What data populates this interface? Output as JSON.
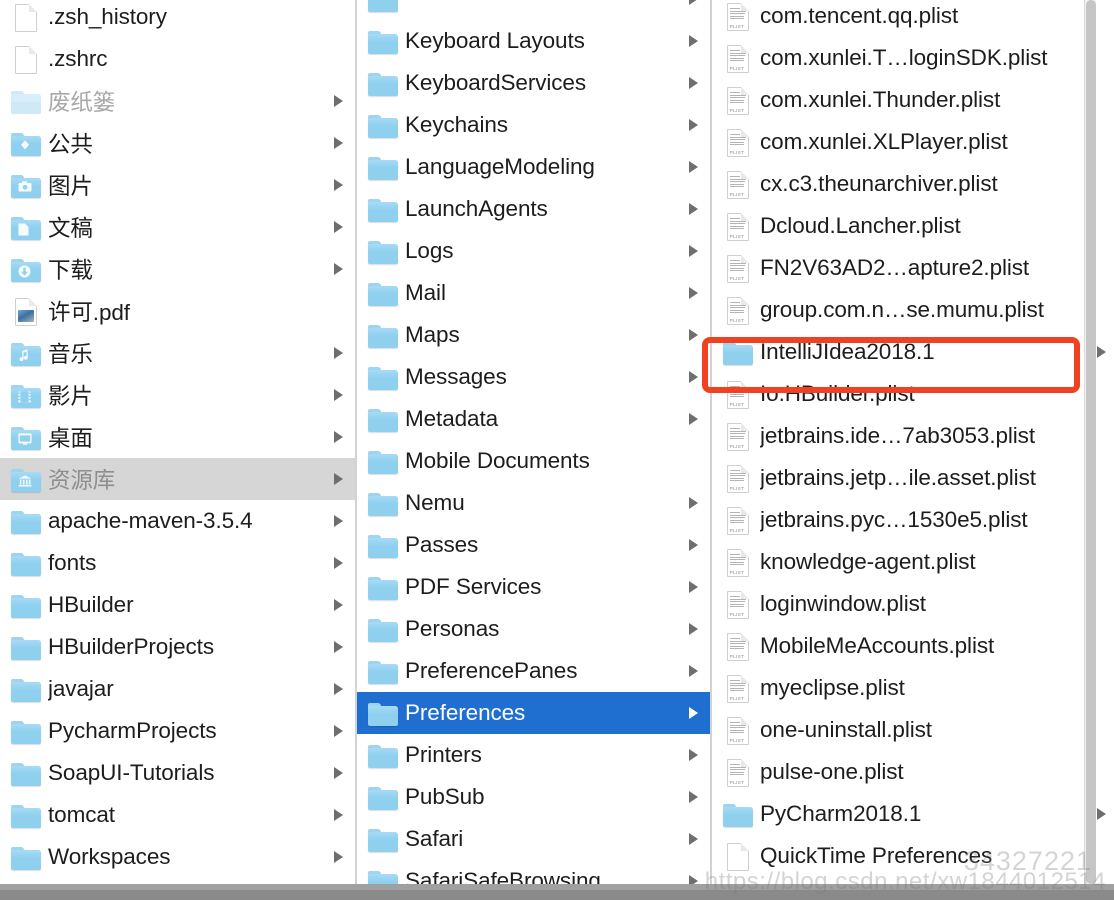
{
  "window": {
    "kind": "macos-finder-column-view",
    "accent_color": "#1f6fd0",
    "highlight_color": "#f04223",
    "folder_color": "#8fd0ef"
  },
  "columns": [
    {
      "name": "home-folder-column",
      "items": [
        {
          "label": ".zsh_history",
          "icon": "document-icon",
          "arrow": false,
          "state": "normal"
        },
        {
          "label": ".zshrc",
          "icon": "document-icon",
          "arrow": false,
          "state": "normal"
        },
        {
          "label": "废纸篓",
          "icon": "folder-icon",
          "arrow": true,
          "state": "dim"
        },
        {
          "label": "公共",
          "icon": "folder-public-icon",
          "arrow": true,
          "state": "normal"
        },
        {
          "label": "图片",
          "icon": "folder-pictures-icon",
          "arrow": true,
          "state": "normal"
        },
        {
          "label": "文稿",
          "icon": "folder-documents-icon",
          "arrow": true,
          "state": "normal"
        },
        {
          "label": "下载",
          "icon": "folder-downloads-icon",
          "arrow": true,
          "state": "normal"
        },
        {
          "label": "许可.pdf",
          "icon": "pdf-icon",
          "arrow": false,
          "state": "normal"
        },
        {
          "label": "音乐",
          "icon": "folder-music-icon",
          "arrow": true,
          "state": "normal"
        },
        {
          "label": "影片",
          "icon": "folder-movies-icon",
          "arrow": true,
          "state": "normal"
        },
        {
          "label": "桌面",
          "icon": "folder-desktop-icon",
          "arrow": true,
          "state": "normal"
        },
        {
          "label": "资源库",
          "icon": "folder-library-icon",
          "arrow": true,
          "state": "selected-inactive"
        },
        {
          "label": "apache-maven-3.5.4",
          "icon": "folder-icon",
          "arrow": true,
          "state": "normal"
        },
        {
          "label": "fonts",
          "icon": "folder-icon",
          "arrow": true,
          "state": "normal"
        },
        {
          "label": "HBuilder",
          "icon": "folder-icon",
          "arrow": true,
          "state": "normal"
        },
        {
          "label": "HBuilderProjects",
          "icon": "folder-icon",
          "arrow": true,
          "state": "normal"
        },
        {
          "label": "javajar",
          "icon": "folder-icon",
          "arrow": true,
          "state": "normal"
        },
        {
          "label": "PycharmProjects",
          "icon": "folder-icon",
          "arrow": true,
          "state": "normal"
        },
        {
          "label": "SoapUI-Tutorials",
          "icon": "folder-icon",
          "arrow": true,
          "state": "normal"
        },
        {
          "label": "tomcat",
          "icon": "folder-icon",
          "arrow": true,
          "state": "normal"
        },
        {
          "label": "Workspaces",
          "icon": "folder-icon",
          "arrow": true,
          "state": "normal"
        }
      ]
    },
    {
      "name": "library-folder-column",
      "items": [
        {
          "label": "",
          "icon": "folder-icon",
          "arrow": true,
          "state": "normal"
        },
        {
          "label": "Keyboard Layouts",
          "icon": "folder-icon",
          "arrow": true,
          "state": "normal"
        },
        {
          "label": "KeyboardServices",
          "icon": "folder-icon",
          "arrow": true,
          "state": "normal"
        },
        {
          "label": "Keychains",
          "icon": "folder-icon",
          "arrow": true,
          "state": "normal"
        },
        {
          "label": "LanguageModeling",
          "icon": "folder-icon",
          "arrow": true,
          "state": "normal"
        },
        {
          "label": "LaunchAgents",
          "icon": "folder-icon",
          "arrow": true,
          "state": "normal"
        },
        {
          "label": "Logs",
          "icon": "folder-icon",
          "arrow": true,
          "state": "normal"
        },
        {
          "label": "Mail",
          "icon": "folder-icon",
          "arrow": true,
          "state": "normal"
        },
        {
          "label": "Maps",
          "icon": "folder-icon",
          "arrow": true,
          "state": "normal"
        },
        {
          "label": "Messages",
          "icon": "folder-icon",
          "arrow": true,
          "state": "normal"
        },
        {
          "label": "Metadata",
          "icon": "folder-icon",
          "arrow": true,
          "state": "normal"
        },
        {
          "label": "Mobile Documents",
          "icon": "folder-icon",
          "arrow": false,
          "state": "normal"
        },
        {
          "label": "Nemu",
          "icon": "folder-icon",
          "arrow": true,
          "state": "normal"
        },
        {
          "label": "Passes",
          "icon": "folder-icon",
          "arrow": true,
          "state": "normal"
        },
        {
          "label": "PDF Services",
          "icon": "folder-icon",
          "arrow": true,
          "state": "normal"
        },
        {
          "label": "Personas",
          "icon": "folder-icon",
          "arrow": true,
          "state": "normal"
        },
        {
          "label": "PreferencePanes",
          "icon": "folder-icon",
          "arrow": true,
          "state": "normal"
        },
        {
          "label": "Preferences",
          "icon": "folder-icon",
          "arrow": true,
          "state": "selected"
        },
        {
          "label": "Printers",
          "icon": "folder-icon",
          "arrow": true,
          "state": "normal"
        },
        {
          "label": "PubSub",
          "icon": "folder-icon",
          "arrow": true,
          "state": "normal"
        },
        {
          "label": "Safari",
          "icon": "folder-icon",
          "arrow": true,
          "state": "normal"
        },
        {
          "label": "SafariSafeBrowsing",
          "icon": "folder-icon",
          "arrow": true,
          "state": "normal"
        }
      ]
    },
    {
      "name": "preferences-contents-column",
      "items": [
        {
          "label": "com.tencent.qq.plist",
          "icon": "plist-file-icon",
          "arrow": false,
          "state": "normal"
        },
        {
          "label": "com.xunlei.T…loginSDK.plist",
          "icon": "plist-file-icon",
          "arrow": false,
          "state": "normal"
        },
        {
          "label": "com.xunlei.Thunder.plist",
          "icon": "plist-file-icon",
          "arrow": false,
          "state": "normal"
        },
        {
          "label": "com.xunlei.XLPlayer.plist",
          "icon": "plist-file-icon",
          "arrow": false,
          "state": "normal"
        },
        {
          "label": "cx.c3.theunarchiver.plist",
          "icon": "plist-file-icon",
          "arrow": false,
          "state": "normal"
        },
        {
          "label": "Dcloud.Lancher.plist",
          "icon": "plist-file-icon",
          "arrow": false,
          "state": "normal"
        },
        {
          "label": "FN2V63AD2…apture2.plist",
          "icon": "plist-file-icon",
          "arrow": false,
          "state": "normal"
        },
        {
          "label": "group.com.n…se.mumu.plist",
          "icon": "plist-file-icon",
          "arrow": false,
          "state": "normal"
        },
        {
          "label": "IntelliJIdea2018.1",
          "icon": "folder-icon",
          "arrow": true,
          "state": "normal",
          "highlighted": true
        },
        {
          "label": "Io.HBuilder.plist",
          "icon": "plist-file-icon",
          "arrow": false,
          "state": "normal"
        },
        {
          "label": "jetbrains.ide…7ab3053.plist",
          "icon": "plist-file-icon",
          "arrow": false,
          "state": "normal"
        },
        {
          "label": "jetbrains.jetp…ile.asset.plist",
          "icon": "plist-file-icon",
          "arrow": false,
          "state": "normal"
        },
        {
          "label": "jetbrains.pyc…1530e5.plist",
          "icon": "plist-file-icon",
          "arrow": false,
          "state": "normal"
        },
        {
          "label": "knowledge-agent.plist",
          "icon": "plist-file-icon",
          "arrow": false,
          "state": "normal"
        },
        {
          "label": "loginwindow.plist",
          "icon": "plist-file-icon",
          "arrow": false,
          "state": "normal"
        },
        {
          "label": "MobileMeAccounts.plist",
          "icon": "plist-file-icon",
          "arrow": false,
          "state": "normal"
        },
        {
          "label": "myeclipse.plist",
          "icon": "plist-file-icon",
          "arrow": false,
          "state": "normal"
        },
        {
          "label": "one-uninstall.plist",
          "icon": "plist-file-icon",
          "arrow": false,
          "state": "normal"
        },
        {
          "label": "pulse-one.plist",
          "icon": "plist-file-icon",
          "arrow": false,
          "state": "normal"
        },
        {
          "label": "PyCharm2018.1",
          "icon": "folder-icon",
          "arrow": true,
          "state": "normal"
        },
        {
          "label": "QuickTime Preferences",
          "icon": "document-icon",
          "arrow": false,
          "state": "normal"
        }
      ]
    }
  ],
  "watermark": {
    "number": "34327221",
    "url": "https://blog.csdn.net/xw1844012514"
  }
}
